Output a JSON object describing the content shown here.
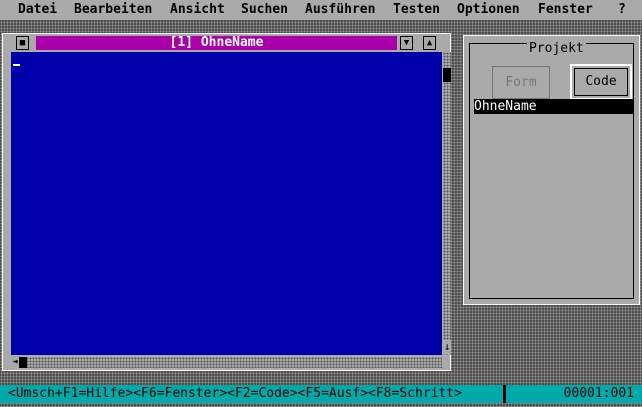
{
  "menu": [
    {
      "label": "Datei"
    },
    {
      "label": "Bearbeiten"
    },
    {
      "label": "Ansicht"
    },
    {
      "label": "Suchen"
    },
    {
      "label": "Ausführen"
    },
    {
      "label": "Testen"
    },
    {
      "label": "Optionen"
    },
    {
      "label": "Fenster"
    },
    {
      "label": "?"
    }
  ],
  "code_window": {
    "title": "[1] OhneName",
    "close_glyph": "■",
    "scroll_down_glyph": "▼",
    "scroll_up_glyph": "▲",
    "vscroll_arrow_glyph": "↓",
    "hscroll_arrow_glyph": "◄"
  },
  "project": {
    "title": "Projekt",
    "form_button": "Form",
    "code_button": "Code",
    "items": [
      "OhneName"
    ]
  },
  "statusbar": {
    "hints": "<Umsch+F1=Hilfe><F6=Fenster><F2=Code><F5=Ausf><F8=Schritt>",
    "position": "00001:001"
  }
}
